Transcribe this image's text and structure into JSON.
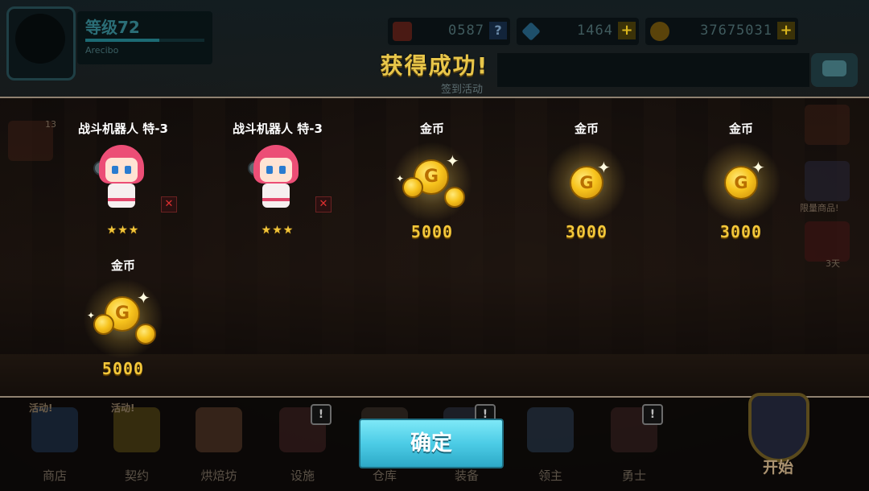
{
  "hud": {
    "level": "等级72",
    "level_progress": 0.62,
    "player_name": "Arecibo",
    "resources": [
      {
        "name": "pvp-token",
        "value": "0587",
        "icon": "question-icon"
      },
      {
        "name": "gems",
        "value": "1464",
        "icon": "plus-icon"
      },
      {
        "name": "gold",
        "value": "37675031",
        "icon": "plus-icon"
      }
    ],
    "event_label": "签到活动"
  },
  "modal": {
    "title": "获得成功!",
    "confirm_label": "确定"
  },
  "rewards": [
    {
      "name": "战斗机器人 特-3",
      "type": "hero",
      "stars": "★★★",
      "amount": ""
    },
    {
      "name": "战斗机器人 特-3",
      "type": "hero",
      "stars": "★★★",
      "amount": ""
    },
    {
      "name": "金币",
      "type": "gold-pile",
      "stars": "",
      "amount": "5000"
    },
    {
      "name": "金币",
      "type": "gold-coin",
      "stars": "",
      "amount": "3000"
    },
    {
      "name": "金币",
      "type": "gold-coin",
      "stars": "",
      "amount": "3000"
    },
    {
      "name": "金币",
      "type": "gold-pile",
      "stars": "",
      "amount": "5000"
    }
  ],
  "side": {
    "mail_count": "13",
    "limited_shop": "限量商品!",
    "gift_timer": "3天"
  },
  "nav": [
    {
      "label": "商店",
      "event": "活动!",
      "alert": false
    },
    {
      "label": "契约",
      "event": "活动!",
      "alert": false
    },
    {
      "label": "烘焙坊",
      "event": "",
      "alert": false
    },
    {
      "label": "设施",
      "event": "",
      "alert": true
    },
    {
      "label": "仓库",
      "event": "",
      "alert": false
    },
    {
      "label": "装备",
      "event": "",
      "alert": true
    },
    {
      "label": "领主",
      "event": "",
      "alert": false
    },
    {
      "label": "勇士",
      "event": "",
      "alert": true
    }
  ],
  "start_label": "开始",
  "colors": {
    "accent_gold": "#f3c73a",
    "confirm_cyan": "#4ccce6",
    "title_gold": "#e8c64a"
  }
}
